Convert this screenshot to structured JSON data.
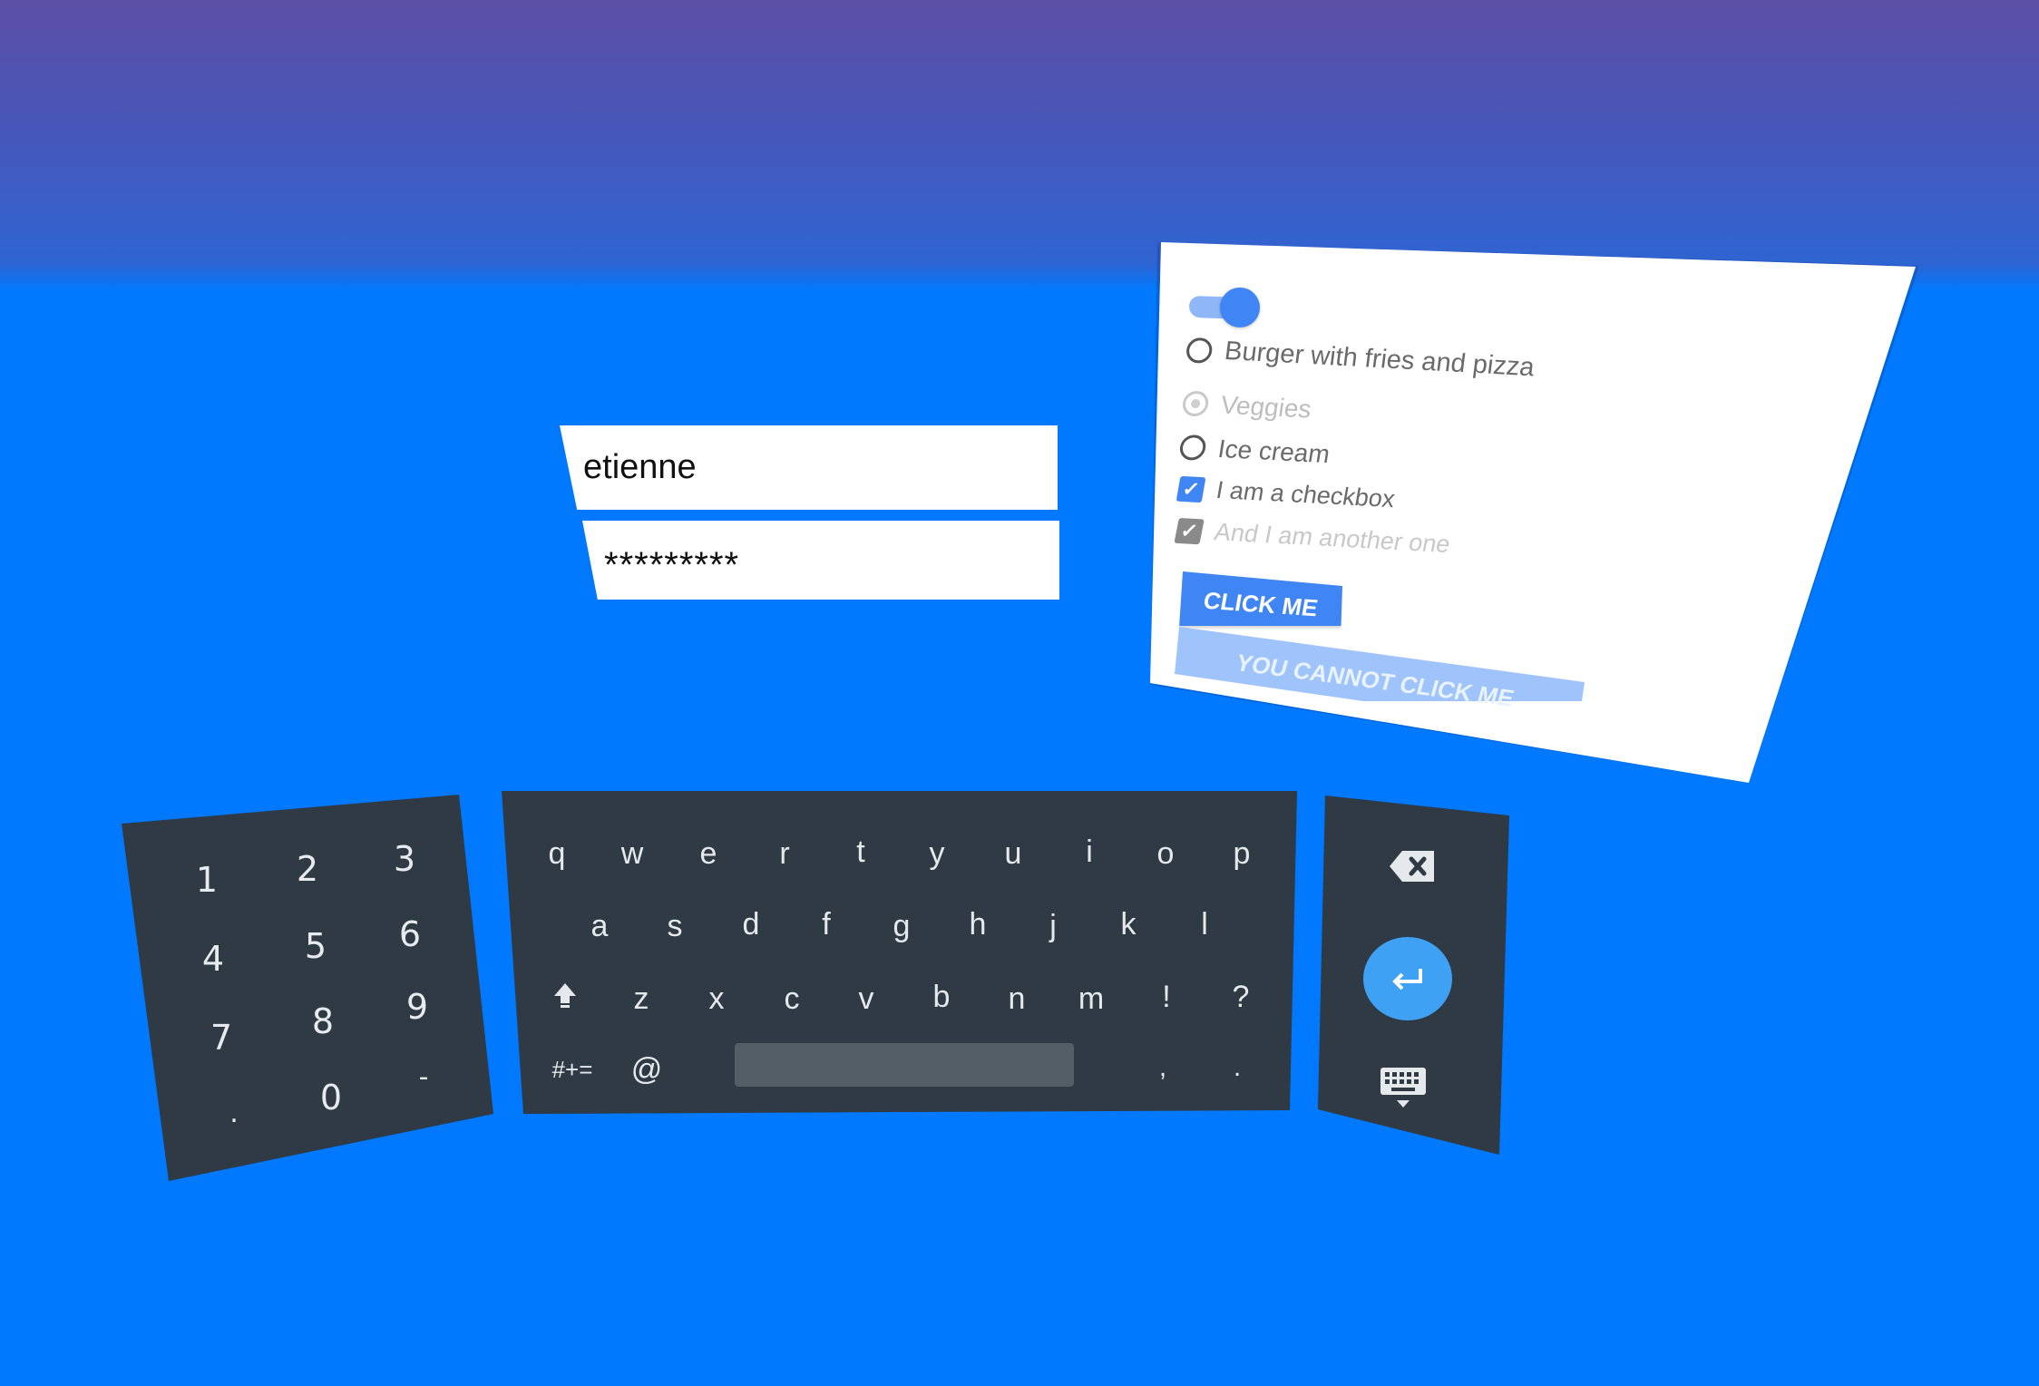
{
  "login": {
    "username_value": "etienne",
    "password_value": "*********"
  },
  "form": {
    "toggle_on": true,
    "options": {
      "burger": "Burger with fries and pizza",
      "veggies": "Veggies",
      "icecream": "Ice cream"
    },
    "checkbox1_label": "I am a checkbox",
    "checkbox2_label": "And I am another one",
    "click_button_label": "CLICK ME",
    "disabled_button_label": "YOU CANNOT CLICK ME",
    "colors": {
      "accent": "#3f86f4",
      "disabled_button": "#9fc3fb"
    }
  },
  "numpad": {
    "keys": [
      "1",
      "2",
      "3",
      "4",
      "5",
      "6",
      "7",
      "8",
      "9",
      ".",
      "0",
      "-"
    ]
  },
  "keyboard": {
    "row1": [
      "q",
      "w",
      "e",
      "r",
      "t",
      "y",
      "u",
      "i",
      "o",
      "p"
    ],
    "row2": [
      "a",
      "s",
      "d",
      "f",
      "g",
      "h",
      "j",
      "k",
      "l"
    ],
    "row3": [
      "z",
      "x",
      "c",
      "v",
      "b",
      "n",
      "m",
      "!",
      "?"
    ],
    "symbols_label": "#+=",
    "at_label": "@",
    "comma_label": ",",
    "period_label": ".",
    "icons": {
      "shift": "shift-icon",
      "backspace": "backspace-icon",
      "enter": "enter-icon",
      "hide_keyboard": "keyboard-hide-icon"
    }
  },
  "background": {
    "sky_top": "#5c4fa6",
    "floor": "#0079fe",
    "keyboard_panel": "#2f3a44",
    "enter_button": "#3ea1f4"
  }
}
